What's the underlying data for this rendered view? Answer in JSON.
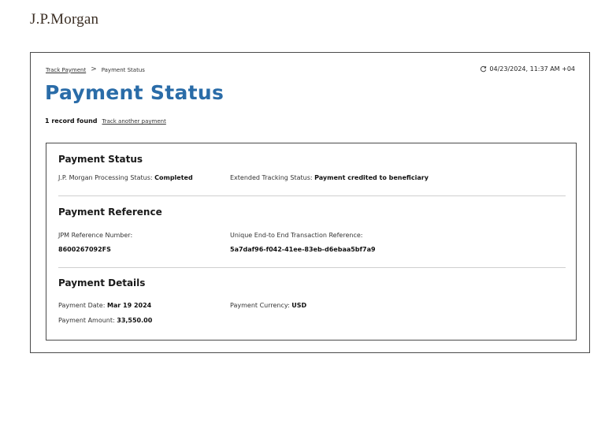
{
  "brand": {
    "logo_text": "J.P.Morgan"
  },
  "breadcrumb": {
    "link_label": "Track Payment",
    "separator": ">",
    "current": "Payment Status"
  },
  "header": {
    "timestamp": "04/23/2024, 11:37 AM +04",
    "title": "Payment Status",
    "record_count": "1 record found",
    "track_another_label": "Track another payment"
  },
  "sections": {
    "status": {
      "title": "Payment Status",
      "processing_label": "J.P. Morgan Processing Status:",
      "processing_value": "Completed",
      "extended_label": "Extended Tracking Status:",
      "extended_value": "Payment credited to beneficiary"
    },
    "reference": {
      "title": "Payment Reference",
      "jpm_ref_label": "JPM Reference Number:",
      "jpm_ref_value": "8600267092FS",
      "uetr_label": "Unique End-to End Transaction Reference:",
      "uetr_value": "5a7daf96-f042-41ee-83eb-d6ebaa5bf7a9"
    },
    "details": {
      "title": "Payment Details",
      "date_label": "Payment Date:",
      "date_value": "Mar 19 2024",
      "currency_label": "Payment Currency:",
      "currency_value": "USD",
      "amount_label": "Payment Amount:",
      "amount_value": "33,550.00"
    }
  },
  "icons": {
    "refresh": "refresh-icon"
  },
  "colors": {
    "title_blue": "#2a6ca8",
    "logo_brown": "#3b2e24"
  }
}
